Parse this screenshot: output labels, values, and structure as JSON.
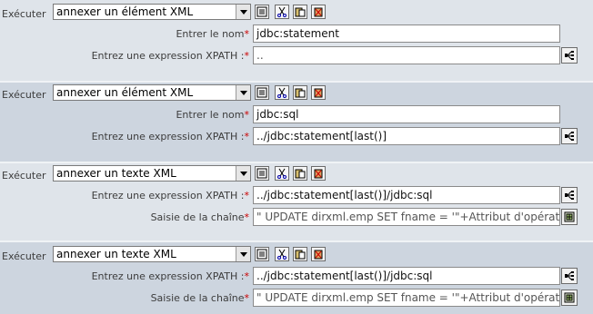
{
  "blocks": [
    {
      "execute_label": "Exécuter",
      "action_value": "annexer un élément XML",
      "fields": [
        {
          "label": "Entrer le nom",
          "value": "jdbc:statement"
        },
        {
          "label": "Entrez une expression XPATH :",
          "value": ".."
        }
      ]
    },
    {
      "execute_label": "Exécuter",
      "action_value": "annexer un élément XML",
      "fields": [
        {
          "label": "Entrer le nom",
          "value": "jdbc:sql"
        },
        {
          "label": "Entrez une expression XPATH :",
          "value": "../jdbc:statement[last()]"
        }
      ]
    },
    {
      "execute_label": "Exécuter",
      "action_value": "annexer un texte XML",
      "fields": [
        {
          "label": "Entrez une expression XPATH :",
          "value": "../jdbc:statement[last()]/jdbc:sql"
        },
        {
          "label": "Saisie de la chaîne",
          "value": "\" UPDATE dirxml.emp SET fname = '\"+Attribut d'opération"
        }
      ]
    },
    {
      "execute_label": "Exécuter",
      "action_value": "annexer un texte XML",
      "fields": [
        {
          "label": "Entrez une expression XPATH :",
          "value": "../jdbc:statement[last()]/jdbc:sql"
        },
        {
          "label": "Saisie de la chaîne",
          "value": "\" UPDATE dirxml.emp SET fname = '\"+Attribut d'opération"
        }
      ]
    }
  ],
  "required_marker": "*",
  "icons": {
    "toolbar": [
      "properties-icon",
      "cut-icon",
      "paste-icon",
      "delete-icon"
    ],
    "xpath_builder": "xpath-builder-icon",
    "string_builder": "string-builder-icon"
  },
  "colors": {
    "required": "#cc0000",
    "panel_light": "#dfe4ea",
    "panel_dark": "#cdd5df"
  }
}
